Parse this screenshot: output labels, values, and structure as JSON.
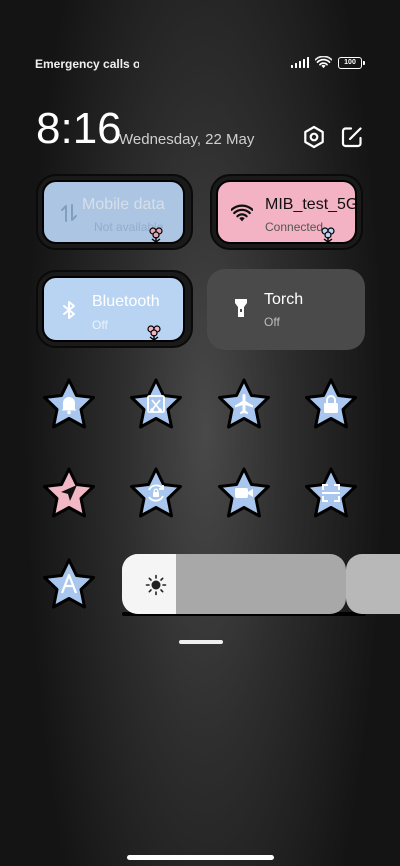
{
  "status": {
    "carrier": "Emergency calls o",
    "battery": "100",
    "icons": [
      "signal-icon",
      "wifi-icon",
      "battery-icon"
    ]
  },
  "header": {
    "time": "8:16",
    "date": "Wednesday, 22 May",
    "icons": [
      "settings-icon",
      "edit-icon"
    ]
  },
  "tiles": [
    {
      "title": "Mobile data",
      "subtitle": "Not available",
      "icon": "mobile-data-icon",
      "state": "inactive",
      "color": "#b9d4f3"
    },
    {
      "title": "MIB_test_5G",
      "subtitle": "Connected",
      "icon": "wifi-icon",
      "state": "active",
      "color": "#f3b3c4"
    },
    {
      "title": "Bluetooth",
      "subtitle": "Off",
      "icon": "bluetooth-icon",
      "state": "off",
      "color": "#b9d4f3"
    },
    {
      "title": "Torch",
      "subtitle": "Off",
      "icon": "torch-icon",
      "state": "off",
      "color": "#4a4a4a"
    }
  ],
  "toggles": [
    {
      "icon": "bell-icon",
      "color": "#a9c6ee"
    },
    {
      "icon": "screenshot-icon",
      "color": "#a9c6ee"
    },
    {
      "icon": "airplane-icon",
      "color": "#a9c6ee"
    },
    {
      "icon": "lock-icon",
      "color": "#a9c6ee"
    },
    {
      "icon": "location-icon",
      "color": "#f2b8c6"
    },
    {
      "icon": "rotation-lock-icon",
      "color": "#a9c6ee"
    },
    {
      "icon": "screen-record-icon",
      "color": "#a9c6ee"
    },
    {
      "icon": "scanner-icon",
      "color": "#a9c6ee"
    },
    {
      "icon": "font-icon",
      "color": "#a9c6ee"
    }
  ],
  "brightness": {
    "level": 0.24,
    "icon": "sun-icon"
  },
  "colors": {
    "blue": "#b9d4f3",
    "pink": "#f3b3c4",
    "dark_tile": "#4a4a4a"
  }
}
